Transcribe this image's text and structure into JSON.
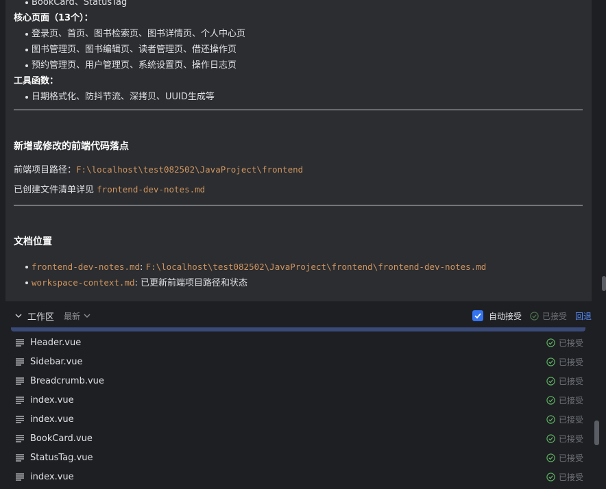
{
  "chat": {
    "top_partial_bullet": "BookCard、StatusTag",
    "core_pages_label": "核心页面（13个）：",
    "core_pages": [
      "登录页、首页、图书检索页、图书详情页、个人中心页",
      "图书管理页、图书编辑页、读者管理页、借还操作页",
      "预约管理页、用户管理页、系统设置页、操作日志页"
    ],
    "tools_label": "工具函数：",
    "tools": [
      "日期格式化、防抖节流、深拷贝、UUID生成等"
    ],
    "section1_title": "新增或修改的前端代码落点",
    "path_label": "前端项目路径：",
    "path_value": "F:\\localhost\\test082502\\JavaProject\\frontend",
    "created_label": "已创建文件清单详见 ",
    "created_value": "frontend-dev-notes.md",
    "section2_title": "文档位置",
    "doc_items": [
      {
        "code": "frontend-dev-notes.md",
        "sep": ": ",
        "text": "F:\\localhost\\test082502\\JavaProject\\frontend\\frontend-dev-notes.md",
        "text_is_code": true
      },
      {
        "code": "workspace-context.md",
        "sep": ": ",
        "text": "已更新前端项目路径和状态",
        "text_is_code": false
      }
    ]
  },
  "workspace": {
    "title": "工作区",
    "sort_label": "最新",
    "auto_accept_label": "自动接受",
    "auto_accept_checked": true,
    "accepted_label": "已接受",
    "revert_label": "回退"
  },
  "files": [
    {
      "name": "Header.vue",
      "status": "已接受"
    },
    {
      "name": "Sidebar.vue",
      "status": "已接受"
    },
    {
      "name": "Breadcrumb.vue",
      "status": "已接受"
    },
    {
      "name": "index.vue",
      "status": "已接受"
    },
    {
      "name": "index.vue",
      "status": "已接受"
    },
    {
      "name": "BookCard.vue",
      "status": "已接受"
    },
    {
      "name": "StatusTag.vue",
      "status": "已接受"
    },
    {
      "name": "index.vue",
      "status": "已接受"
    }
  ],
  "colors": {
    "accent": "#3574f0",
    "code": "#d0945f",
    "link": "#548af7",
    "accepted_icon": "#5fb865"
  }
}
